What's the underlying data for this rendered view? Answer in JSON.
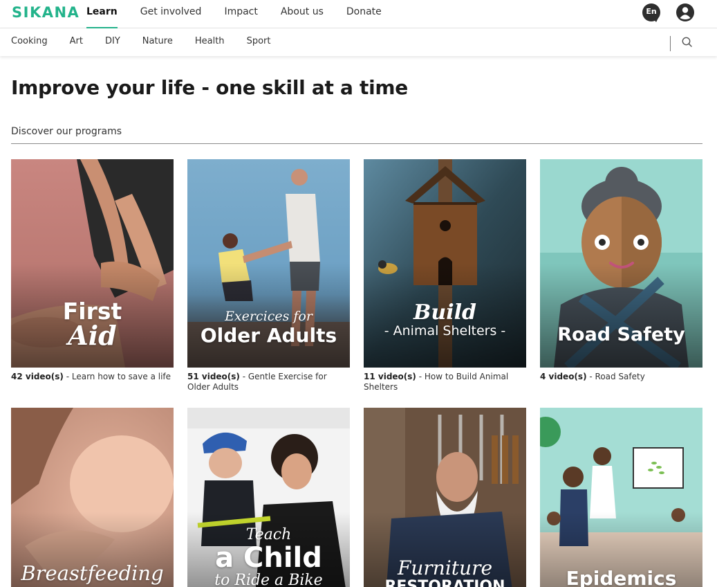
{
  "brand": {
    "logo": "SIKANA",
    "accent": "#23b38b"
  },
  "mainnav": [
    {
      "label": "Learn",
      "active": true
    },
    {
      "label": "Get involved"
    },
    {
      "label": "Impact"
    },
    {
      "label": "About us"
    },
    {
      "label": "Donate"
    }
  ],
  "language": {
    "label": "En"
  },
  "user": {
    "icon": "user-icon"
  },
  "subnav": [
    "Cooking",
    "Art",
    "DIY",
    "Nature",
    "Health",
    "Sport"
  ],
  "search": {
    "icon": "search-icon"
  },
  "page": {
    "headline": "Improve your life - one skill at a time",
    "section_label": "Discover our programs"
  },
  "programs": [
    {
      "title_line1": "First",
      "title_line2": "Aid",
      "count": "42 video(s)",
      "desc": "Learn how to save a life"
    },
    {
      "title_line1": "Exercices for",
      "title_line2": "Older Adults",
      "count": "51 video(s)",
      "desc": "Gentle Exercise for Older Adults"
    },
    {
      "title_line1": "Build",
      "title_line2": "- Animal Shelters -",
      "count": "11 video(s)",
      "desc": "How to Build Animal Shelters"
    },
    {
      "title_line1": "Road Safety",
      "count": "4 video(s)",
      "desc": "Road Safety"
    },
    {
      "title_line1": "Breastfeeding"
    },
    {
      "title_line1": "Teach",
      "title_line2": "a Child",
      "title_line3": "to Ride a Bike"
    },
    {
      "title_line1": "Furniture",
      "title_line2": "RESTORATION"
    },
    {
      "title_line1": "Epidemics"
    }
  ]
}
